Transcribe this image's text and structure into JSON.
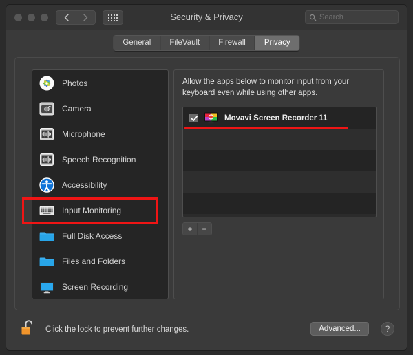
{
  "window": {
    "title": "Security & Privacy",
    "traffic_lights": [
      "close",
      "minimize",
      "zoom"
    ],
    "nav_back": "‹",
    "nav_forward": "›",
    "grid_button_icon": "grid-view-icon",
    "search": {
      "placeholder": "Search",
      "value": "",
      "icon": "search-icon"
    }
  },
  "tabs": [
    {
      "label": "General",
      "selected": false
    },
    {
      "label": "FileVault",
      "selected": false
    },
    {
      "label": "Firewall",
      "selected": false
    },
    {
      "label": "Privacy",
      "selected": true
    }
  ],
  "sidebar": {
    "items": [
      {
        "label": "Photos",
        "icon": "photos-icon"
      },
      {
        "label": "Camera",
        "icon": "camera-icon"
      },
      {
        "label": "Microphone",
        "icon": "microphone-icon"
      },
      {
        "label": "Speech Recognition",
        "icon": "speech-recognition-icon"
      },
      {
        "label": "Accessibility",
        "icon": "accessibility-icon"
      },
      {
        "label": "Input Monitoring",
        "icon": "keyboard-icon"
      },
      {
        "label": "Full Disk Access",
        "icon": "folder-icon"
      },
      {
        "label": "Files and Folders",
        "icon": "folder-icon"
      },
      {
        "label": "Screen Recording",
        "icon": "display-icon"
      }
    ],
    "highlighted_item": "Input Monitoring"
  },
  "detail": {
    "description": "Allow the apps below to monitor input from your keyboard even while using other apps.",
    "apps": [
      {
        "name": "Movavi Screen Recorder 11",
        "checked": true,
        "icon": "movavi-screen-recorder-icon"
      }
    ],
    "add_button": "+",
    "remove_button": "−"
  },
  "bottom": {
    "lock_icon": "unlocked-padlock-icon",
    "lock_text": "Click the lock to prevent further changes.",
    "advanced_label": "Advanced...",
    "help_label": "?"
  },
  "colors": {
    "annotation": "#ef1515",
    "window_bg": "#3a3a3a",
    "list_bg": "#252525",
    "accent_lock": "#f0942b"
  }
}
